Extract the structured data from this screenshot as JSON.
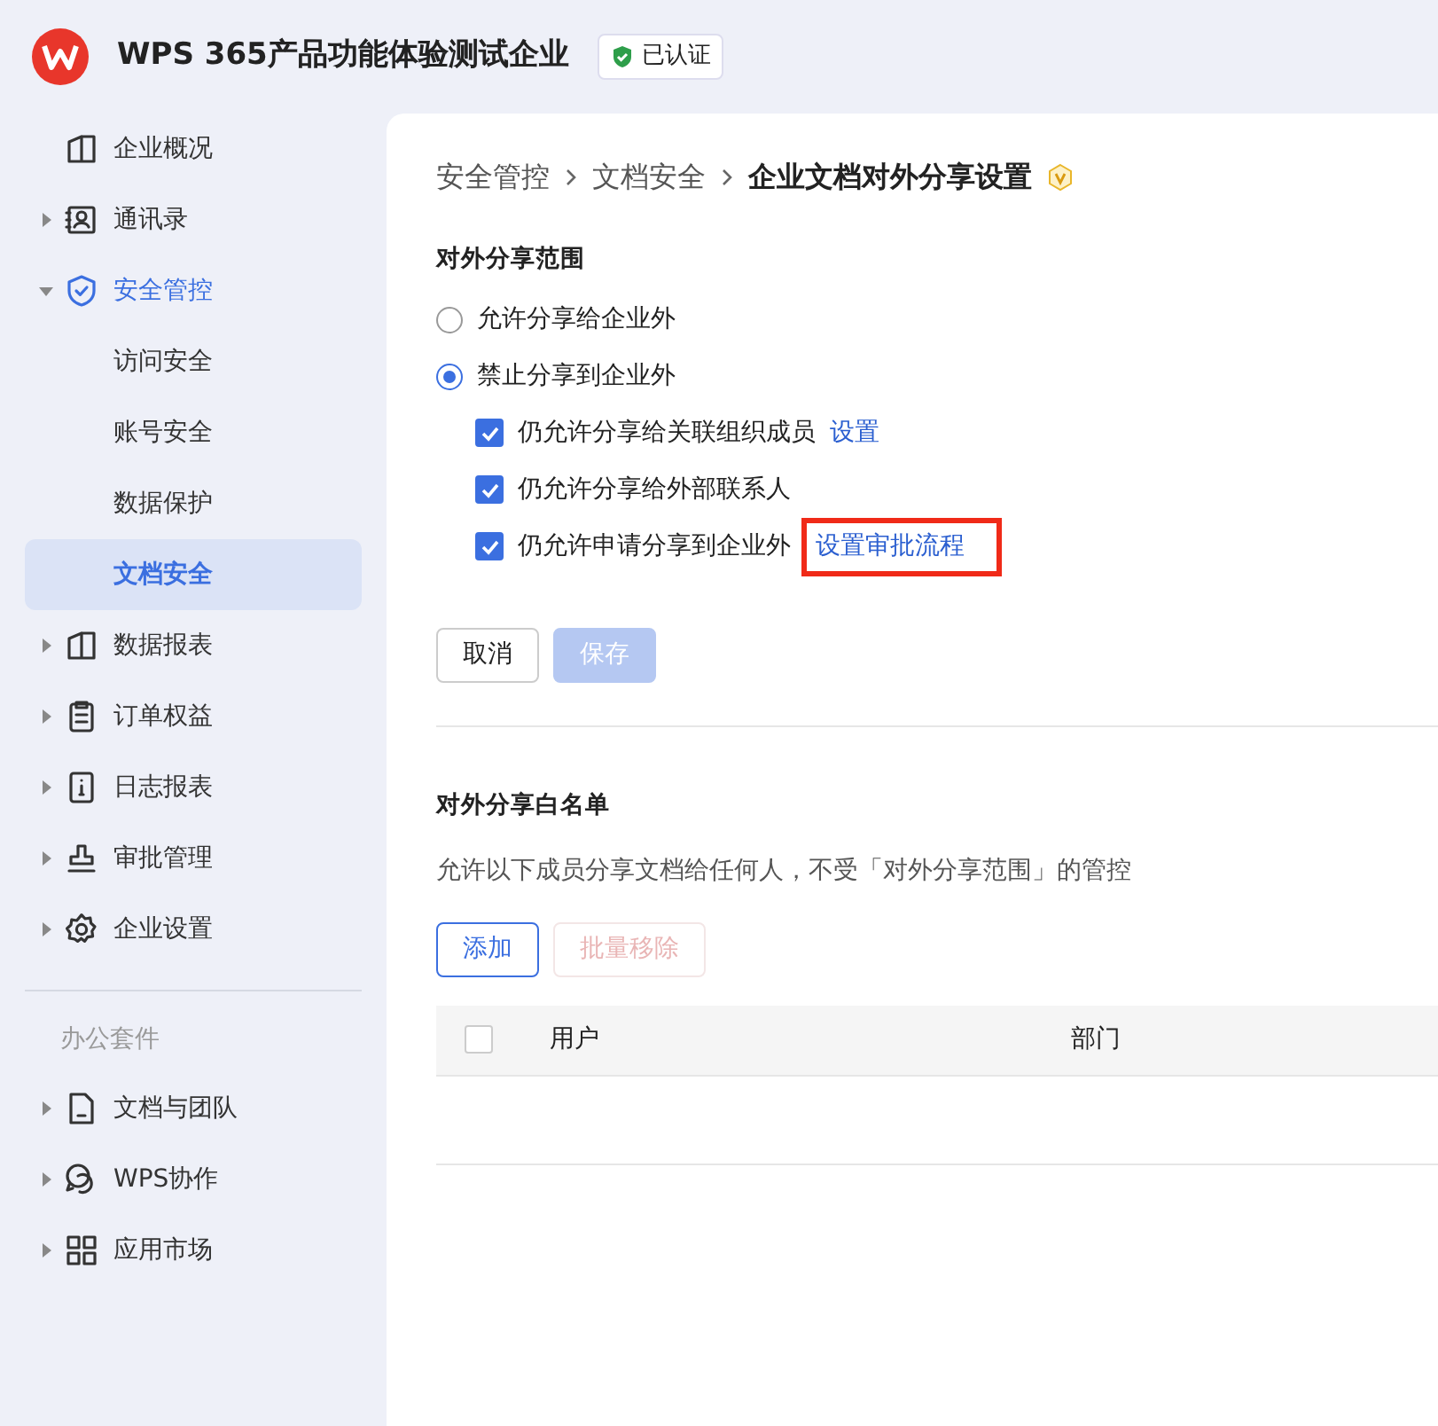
{
  "header": {
    "org_name": "WPS 365产品功能体验测试企业",
    "verified_badge": "已认证"
  },
  "sidebar": {
    "items": [
      {
        "label": "企业概况",
        "expandable": false,
        "active": false
      },
      {
        "label": "通讯录",
        "expandable": true,
        "expanded": false,
        "active": false
      },
      {
        "label": "安全管控",
        "expandable": true,
        "expanded": true,
        "active": true,
        "children": [
          {
            "label": "访问安全",
            "selected": false
          },
          {
            "label": "账号安全",
            "selected": false
          },
          {
            "label": "数据保护",
            "selected": false
          },
          {
            "label": "文档安全",
            "selected": true
          }
        ]
      },
      {
        "label": "数据报表",
        "expandable": true,
        "expanded": false,
        "active": false
      },
      {
        "label": "订单权益",
        "expandable": true,
        "expanded": false,
        "active": false
      },
      {
        "label": "日志报表",
        "expandable": true,
        "expanded": false,
        "active": false
      },
      {
        "label": "审批管理",
        "expandable": true,
        "expanded": false,
        "active": false
      },
      {
        "label": "企业设置",
        "expandable": true,
        "expanded": false,
        "active": false
      }
    ],
    "section_label": "办公套件",
    "apps": [
      {
        "label": "文档与团队",
        "expandable": true,
        "expanded": false,
        "active": false
      },
      {
        "label": "WPS协作",
        "expandable": true,
        "expanded": false,
        "active": false
      },
      {
        "label": "应用市场",
        "expandable": true,
        "expanded": false,
        "active": false
      }
    ]
  },
  "breadcrumb": [
    "安全管控",
    "文档安全",
    "企业文档对外分享设置"
  ],
  "scope": {
    "title": "对外分享范围",
    "radios": [
      {
        "label": "允许分享给企业外",
        "selected": false
      },
      {
        "label": "禁止分享到企业外",
        "selected": true
      }
    ],
    "options": [
      {
        "label": "仍允许分享给关联组织成员",
        "checked": true,
        "link": "设置",
        "highlighted": false
      },
      {
        "label": "仍允许分享给外部联系人",
        "checked": true
      },
      {
        "label": "仍允许申请分享到企业外",
        "checked": true,
        "link": "设置审批流程",
        "highlighted": true
      }
    ],
    "buttons": [
      {
        "label": "取消",
        "kind": "outline",
        "disabled": false
      },
      {
        "label": "保存",
        "kind": "primary",
        "disabled": true
      }
    ]
  },
  "whitelist": {
    "title": "对外分享白名单",
    "description": "允许以下成员分享文档给任何人，不受「对外分享范围」的管控",
    "buttons": [
      {
        "label": "添加",
        "kind": "outline-primary",
        "disabled": false
      },
      {
        "label": "批量移除",
        "kind": "outline-danger",
        "disabled": true
      }
    ],
    "table": {
      "select_all": false,
      "columns": [
        "用户",
        "部门"
      ]
    }
  }
}
